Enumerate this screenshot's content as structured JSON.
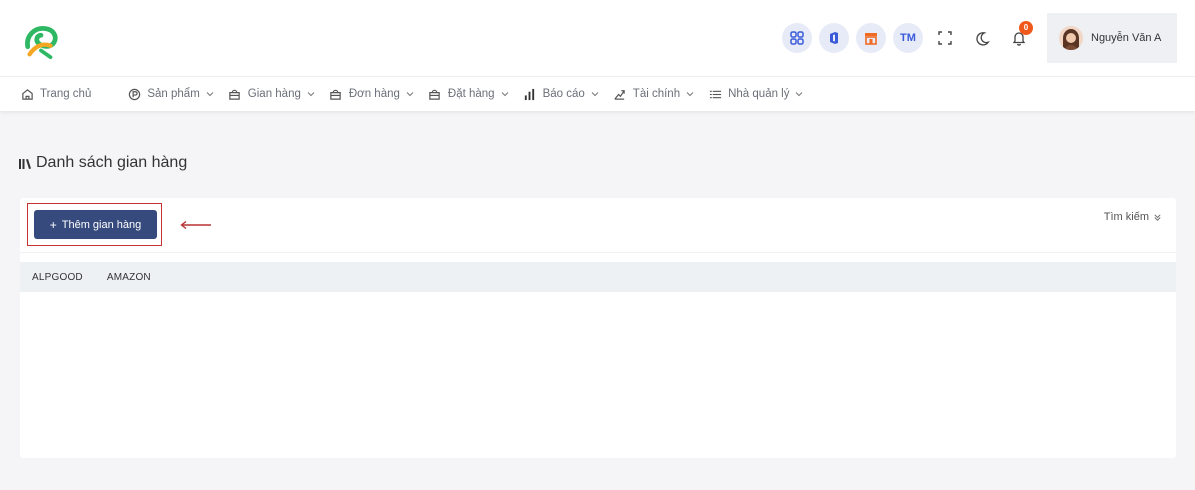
{
  "header": {
    "logo_icon": "brand-logo-icon",
    "quick_icons": [
      {
        "name": "apps-grid-icon",
        "text": ""
      },
      {
        "name": "office-icon",
        "text": ""
      },
      {
        "name": "store-icon",
        "text": ""
      },
      {
        "name": "tm-shortcut",
        "text": "TM"
      }
    ],
    "fullscreen_icon": "fullscreen-icon",
    "theme_icon": "moon-icon",
    "notifications": {
      "icon": "bell-icon",
      "count": "0"
    },
    "user": {
      "name": "Nguyễn Văn A",
      "avatar": "avatar-icon"
    }
  },
  "nav": {
    "items": [
      {
        "label": "Trang chủ",
        "icon": "home-icon",
        "has_menu": false
      },
      {
        "label": "Sản phẩm",
        "icon": "product-icon",
        "has_menu": true
      },
      {
        "label": "Gian hàng",
        "icon": "bag-icon",
        "has_menu": true
      },
      {
        "label": "Đơn hàng",
        "icon": "bag-icon",
        "has_menu": true
      },
      {
        "label": "Đặt hàng",
        "icon": "bag-icon",
        "has_menu": true
      },
      {
        "label": "Báo cáo",
        "icon": "bar-chart-icon",
        "has_menu": true
      },
      {
        "label": "Tài chính",
        "icon": "finance-icon",
        "has_menu": true
      },
      {
        "label": "Nhà quản lý",
        "icon": "list-icon",
        "has_menu": true
      }
    ]
  },
  "page": {
    "title": "Danh sách gian hàng",
    "title_icon": "library-icon"
  },
  "toolbar": {
    "add_label": "Thêm gian hàng",
    "search_label": "Tìm kiếm"
  },
  "tabs": [
    "ALPGOOD",
    "AMAZON"
  ],
  "colors": {
    "primary_button": "#364a7d",
    "highlight_border": "#c73232",
    "badge": "#ef5a1c",
    "accent_blue": "#3a5bd9"
  }
}
